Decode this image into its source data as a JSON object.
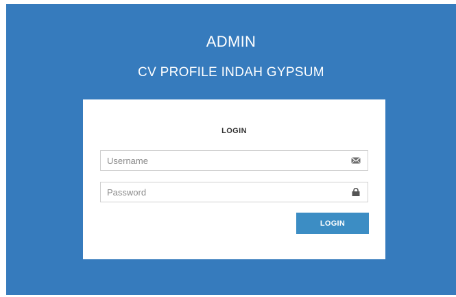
{
  "header": {
    "title": "ADMIN",
    "subtitle": "CV PROFILE INDAH GYPSUM"
  },
  "login_form": {
    "heading": "LOGIN",
    "username": {
      "value": "",
      "placeholder": "Username",
      "icon": "envelope-icon"
    },
    "password": {
      "value": "",
      "placeholder": "Password",
      "icon": "lock-icon"
    },
    "submit_label": "LOGIN"
  },
  "colors": {
    "background": "#367bbd",
    "card": "#ffffff",
    "button": "#3c8dc4"
  }
}
